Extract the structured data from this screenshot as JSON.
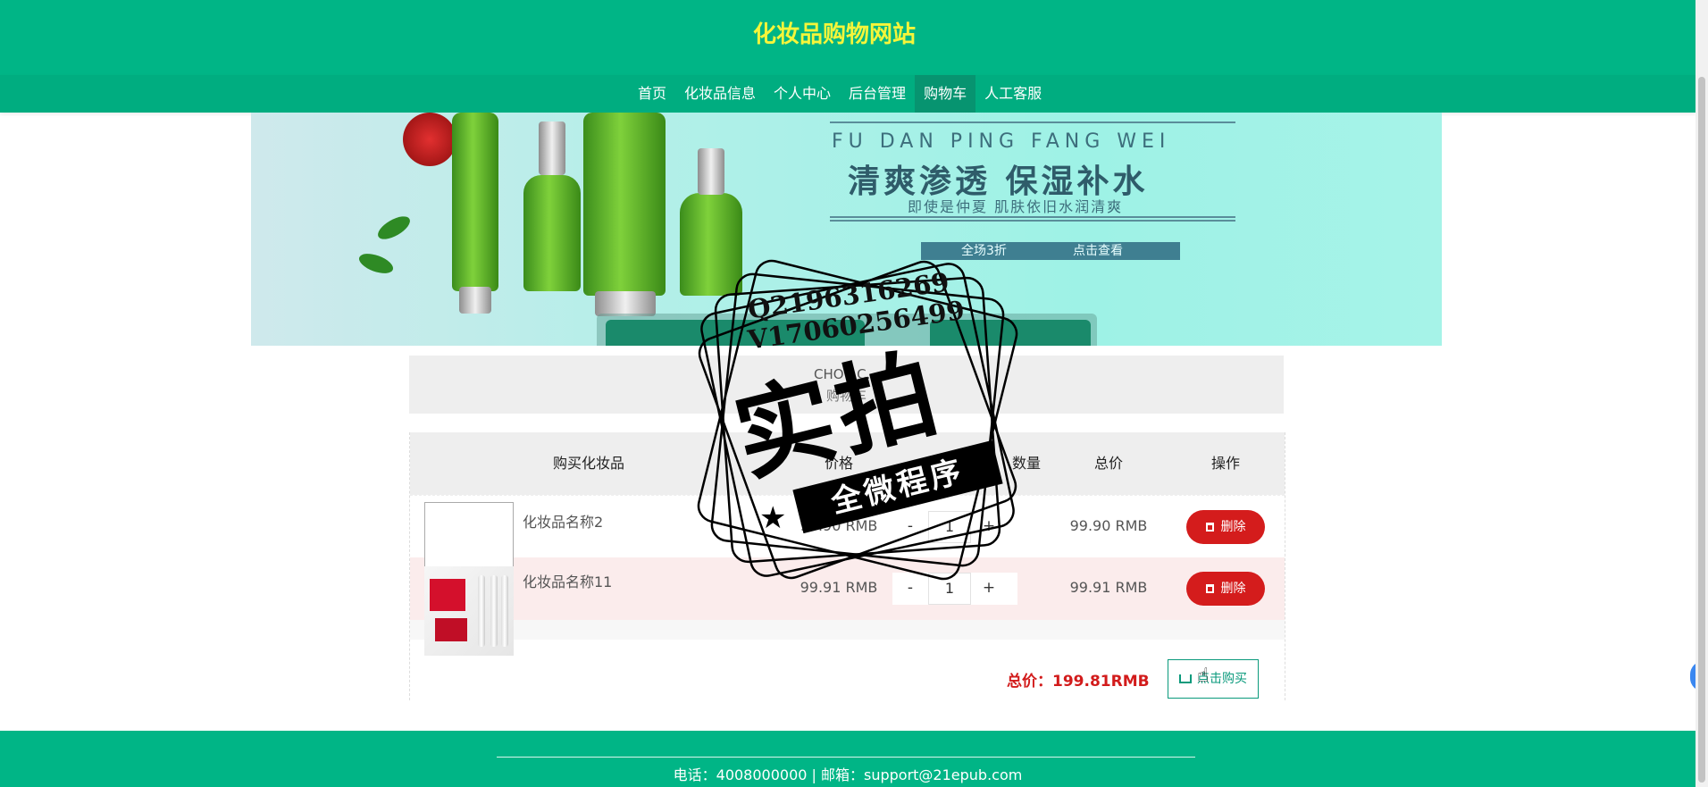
{
  "site": {
    "title": "化妆品购物网站"
  },
  "nav": {
    "items": [
      {
        "label": "首页"
      },
      {
        "label": "化妆品信息"
      },
      {
        "label": "个人中心"
      },
      {
        "label": "后台管理"
      },
      {
        "label": "购物车",
        "active": true
      },
      {
        "label": "人工客服"
      }
    ]
  },
  "banner": {
    "headline_en": "FU DAN PING FANG WEI",
    "headline_cn": "清爽渗透 保湿补水",
    "subline": "即使是仲夏 肌肤依旧水润清爽",
    "promo_left": "全场3折",
    "promo_right": "点击查看"
  },
  "breadcrumb": {
    "path": "CHO / C...",
    "current": "购物车"
  },
  "cart": {
    "columns": [
      "购买化妆品",
      "价格",
      "数量",
      "总价",
      "操作"
    ],
    "rows": [
      {
        "name": "化妆品名称2",
        "price": "99.90 RMB",
        "quantity": "1",
        "total": "99.90 RMB",
        "delete_label": "删除"
      },
      {
        "name": "化妆品名称11",
        "price": "99.91 RMB",
        "quantity": "1",
        "total": "99.91 RMB",
        "delete_label": "删除"
      }
    ],
    "minus": "-",
    "plus": "+",
    "grand_total": "总价：199.81RMB",
    "buy_label": "点击购买"
  },
  "footer": {
    "contact": "电话：4008000000 | 邮箱：support@21epub.com"
  },
  "side_button": {
    "glyph": "‹"
  },
  "watermark": {
    "line1": "Q2196316269",
    "line2": "V17060256499",
    "big": "实拍",
    "banner": "全微程序"
  },
  "colors": {
    "primary": "#00b586",
    "title": "#f5f53a",
    "danger": "#d41c1c",
    "accent": "#0a9a7c"
  }
}
